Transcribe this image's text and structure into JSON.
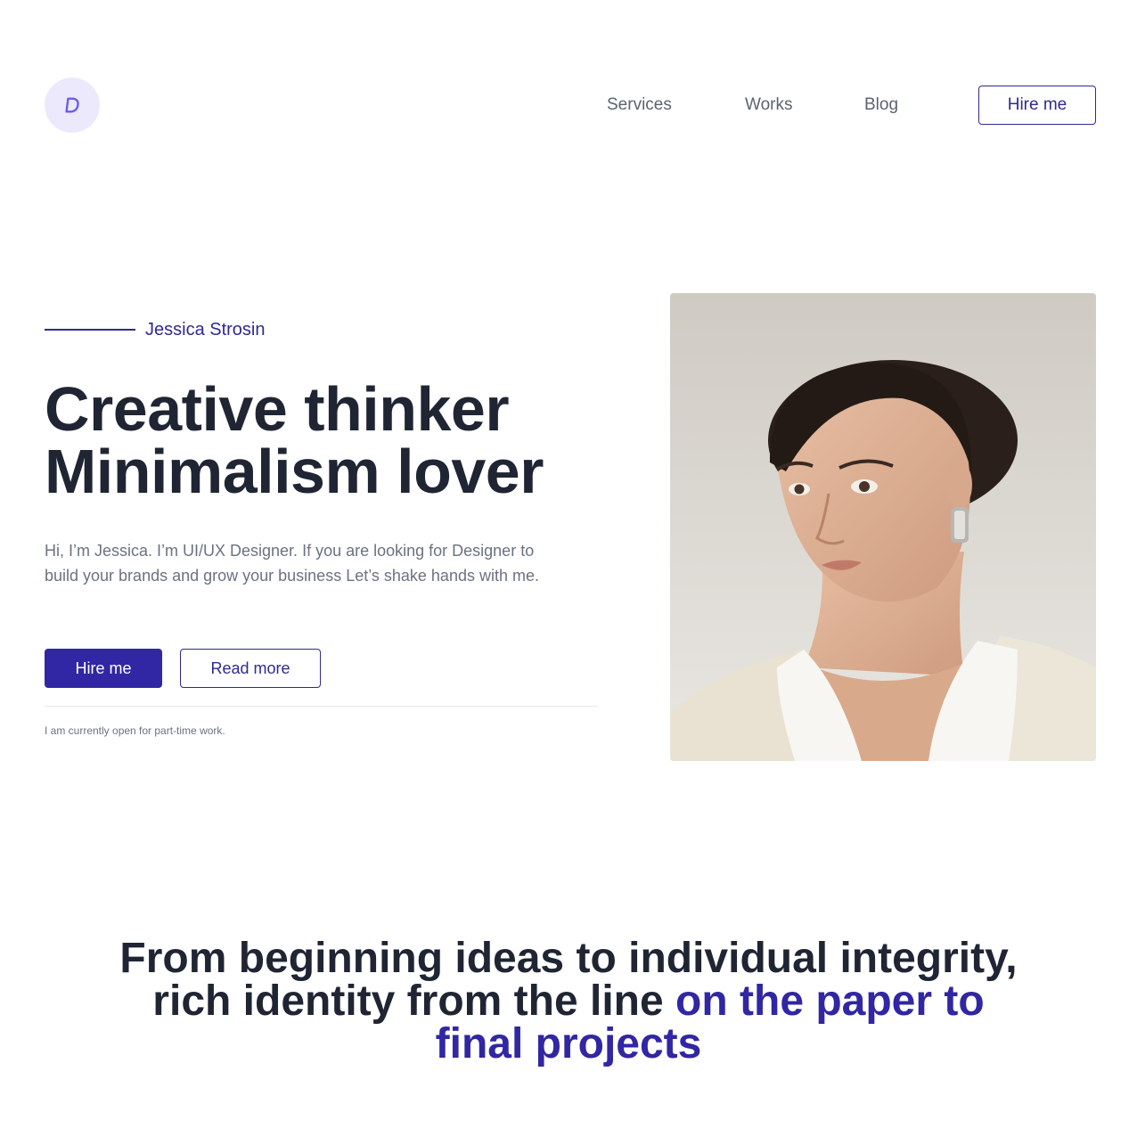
{
  "header": {
    "logo_icon": "logo-d-icon",
    "nav": [
      {
        "label": "Services"
      },
      {
        "label": "Works"
      },
      {
        "label": "Blog"
      }
    ],
    "cta_label": "Hire me"
  },
  "hero": {
    "eyebrow_name": "Jessica Strosin",
    "title_line1": "Creative thinker",
    "title_line2": "Minimalism lover",
    "description": "Hi, I’m Jessica. I’m UI/UX Designer. If you are looking for Designer to build your brands and grow your business Let’s shake hands with me.",
    "primary_button": "Hire me",
    "secondary_button": "Read more",
    "availability_note": "I am currently open for part-time work."
  },
  "statement": {
    "line1": "From beginning ideas to individual integrity,",
    "line2_plain": "rich identity from the line ",
    "line2_accent": "on the paper to",
    "line3_accent": "final projects"
  },
  "colors": {
    "accent": "#3126a3",
    "text_dark": "#1f2533",
    "text_muted": "#6b7280",
    "logo_bg": "#ede9fd"
  }
}
